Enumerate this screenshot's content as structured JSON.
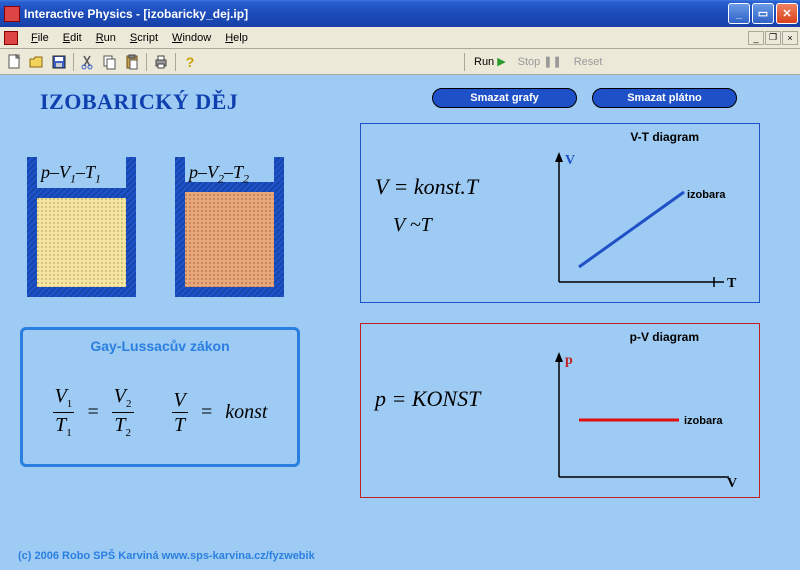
{
  "window": {
    "title": "Interactive Physics - [izobaricky_dej.ip]"
  },
  "menu": {
    "file": "File",
    "edit": "Edit",
    "run": "Run",
    "script": "Script",
    "window": "Window",
    "help": "Help"
  },
  "toolbar": {
    "run": "Run",
    "stop": "Stop",
    "reset": "Reset"
  },
  "content": {
    "title": "IZOBARICKÝ DĚJ",
    "btn_clear_graphs": "Smazat grafy",
    "btn_clear_canvas": "Smazat plátno",
    "cyl1_label_html": "p–V₁–T₁",
    "cyl2_label_html": "p–V₂–T₂",
    "law_title": "Gay-Lussacův zákon",
    "konst": "konst",
    "vt_title": "V-T diagram",
    "vt_f1": "V = konst.T",
    "vt_f2": "V ~T",
    "vt_y": "V",
    "vt_x": "T",
    "vt_series": "izobara",
    "pv_title": "p-V diagram",
    "pv_f1": "p = KONST",
    "pv_y": "p",
    "pv_x": "V",
    "pv_series": "izobara",
    "footer": "(c) 2006 Robo SPŠ Karviná  www.sps-karvina.cz/fyzwebik"
  }
}
